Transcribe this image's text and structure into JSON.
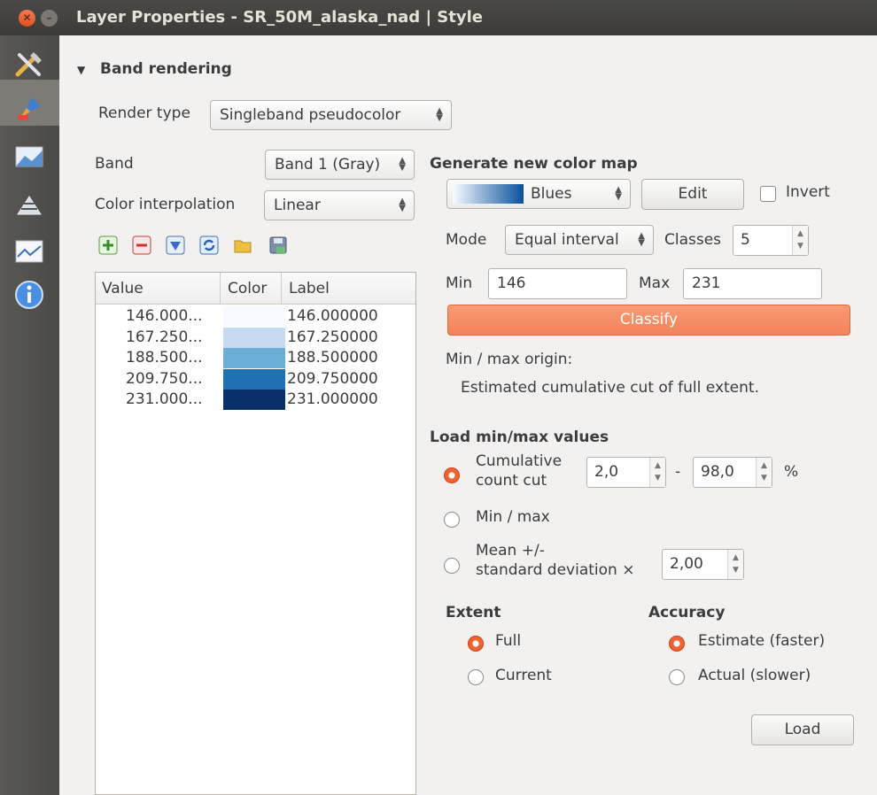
{
  "window": {
    "title": "Layer Properties - SR_50M_alaska_nad | Style"
  },
  "sidebar": {
    "icons": [
      "general-icon",
      "style-icon",
      "transparency-icon",
      "pyramids-icon",
      "histogram-icon",
      "metadata-icon"
    ]
  },
  "section": {
    "title": "Band rendering"
  },
  "render_type": {
    "label": "Render type",
    "value": "Singleband pseudocolor"
  },
  "band": {
    "label": "Band",
    "value": "Band 1 (Gray)"
  },
  "interpolation": {
    "label": "Color interpolation",
    "value": "Linear"
  },
  "table": {
    "headers": {
      "value": "Value",
      "color": "Color",
      "label": "Label"
    },
    "rows": [
      {
        "value": "146.000...",
        "color": "#f7fbff",
        "label": "146.000000"
      },
      {
        "value": "167.250...",
        "color": "#c6dbef",
        "label": "167.250000"
      },
      {
        "value": "188.500...",
        "color": "#6baed6",
        "label": "188.500000"
      },
      {
        "value": "209.750...",
        "color": "#2171b5",
        "label": "209.750000"
      },
      {
        "value": "231.000...",
        "color": "#08306b",
        "label": "231.000000"
      }
    ]
  },
  "colormap": {
    "title": "Generate new color map",
    "ramp": "Blues",
    "edit_label": "Edit",
    "invert_label": "Invert",
    "mode_label": "Mode",
    "mode_value": "Equal interval",
    "classes_label": "Classes",
    "classes_value": "5",
    "min_label": "Min",
    "min_value": "146",
    "max_label": "Max",
    "max_value": "231",
    "classify_label": "Classify",
    "origin_label": "Min / max origin:",
    "origin_value": "Estimated cumulative cut of full extent."
  },
  "load": {
    "title": "Load min/max values",
    "cumulative_label_1": "Cumulative",
    "cumulative_label_2": "count cut",
    "cum_low": "2,0",
    "dash": "-",
    "cum_high": "98,0",
    "percent": "%",
    "minmax_label": "Min / max",
    "mean_label_1": "Mean +/-",
    "mean_label_2": "standard deviation ×",
    "stddev": "2,00",
    "extent_title": "Extent",
    "extent_full": "Full",
    "extent_current": "Current",
    "accuracy_title": "Accuracy",
    "accuracy_estimate": "Estimate (faster)",
    "accuracy_actual": "Actual (slower)",
    "load_button": "Load"
  },
  "colors": {
    "accent": "#ef6331",
    "classify_bg": "#f8906a",
    "selection_sidebar": "#7d7b75"
  }
}
